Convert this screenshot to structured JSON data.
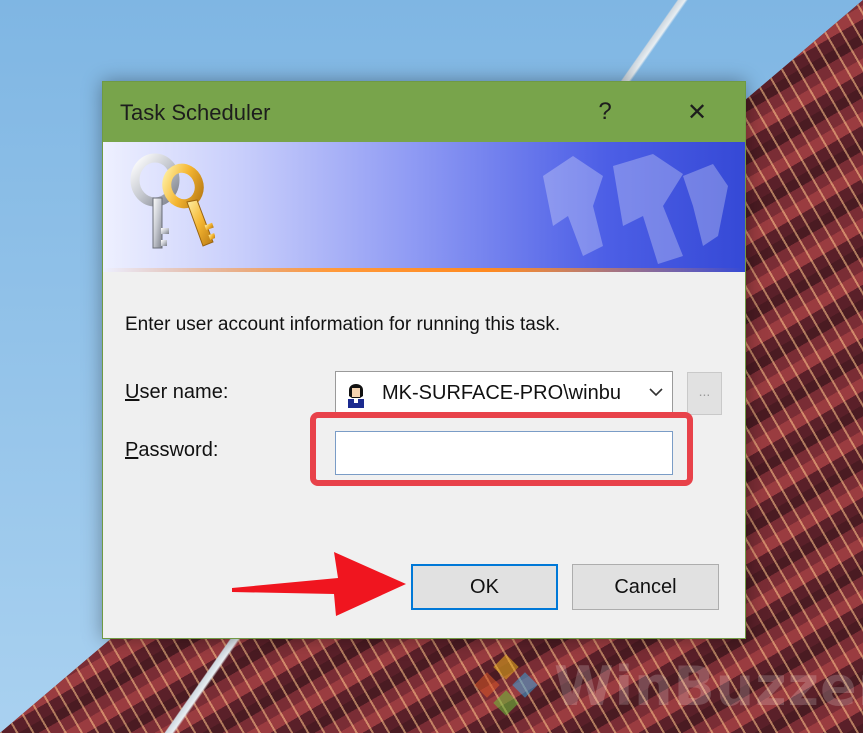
{
  "dialog": {
    "title": "Task Scheduler",
    "help_glyph": "?",
    "close_glyph": "✕",
    "instruction": "Enter user account information for running this task.",
    "user_name_label": {
      "mnemonic": "U",
      "rest": "ser name:"
    },
    "user_name_value": "MK-SURFACE-PRO\\winbu",
    "password_label": {
      "mnemonic": "P",
      "rest": "assword:"
    },
    "password_value": "",
    "browse_label": "...",
    "ok_label": "OK",
    "cancel_label": "Cancel"
  },
  "icons": {
    "banner": "keys-icon",
    "user": "user-avatar-icon",
    "dropdown": "chevron-down-icon"
  },
  "watermark": {
    "text": "WinBuzzer"
  },
  "colors": {
    "titlebar": "#78a44b",
    "highlight": "#e8424a",
    "default_button_border": "#0078d7"
  }
}
